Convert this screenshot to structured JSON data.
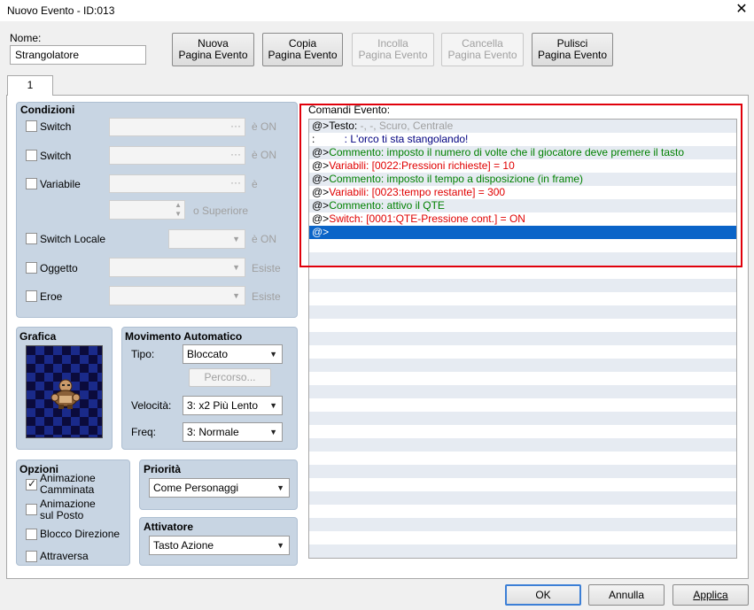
{
  "window": {
    "title": "Nuovo Evento - ID:013",
    "close_glyph": "✕"
  },
  "name": {
    "label": "Nome:",
    "value": "Strangolatore"
  },
  "toolbar": {
    "new_page": [
      "Nuova",
      "Pagina Evento"
    ],
    "copy_page": [
      "Copia",
      "Pagina Evento"
    ],
    "paste_page": [
      "Incolla",
      "Pagina Evento"
    ],
    "delete_page": [
      "Cancella",
      "Pagina Evento"
    ],
    "clear_page": [
      "Pulisci",
      "Pagina Evento"
    ]
  },
  "tabs": [
    {
      "label": "1"
    }
  ],
  "conditions": {
    "title": "Condizioni",
    "switch1": {
      "label": "Switch",
      "suffix": "è ON"
    },
    "switch2": {
      "label": "Switch",
      "suffix": "è ON"
    },
    "variable": {
      "label": "Variabile",
      "suffix": "è",
      "or_higher": "o Superiore"
    },
    "self_switch": {
      "label": "Switch Locale",
      "suffix": "è ON"
    },
    "item": {
      "label": "Oggetto",
      "suffix": "Esiste"
    },
    "actor": {
      "label": "Eroe",
      "suffix": "Esiste"
    }
  },
  "graphic": {
    "title": "Grafica"
  },
  "autonomous": {
    "title": "Movimento Automatico",
    "type_label": "Tipo:",
    "type_value": "Bloccato",
    "route_button": "Percorso...",
    "speed_label": "Velocità:",
    "speed_value": "3: x2 Più Lento",
    "freq_label": "Freq:",
    "freq_value": "3: Normale"
  },
  "options": {
    "title": "Opzioni",
    "walking_anim": [
      "Animazione",
      "Camminata"
    ],
    "stepping_anim": [
      "Animazione",
      "sul Posto"
    ],
    "direction_fix": "Blocco Direzione",
    "through": "Attraversa"
  },
  "priority": {
    "title": "Priorità",
    "value": "Come Personaggi"
  },
  "trigger": {
    "title": "Attivatore",
    "value": "Tasto Azione"
  },
  "commands": {
    "title": "Comandi Evento:",
    "lines": [
      {
        "prefix": "@>Testo",
        "text": ": ",
        "extra": "-, -, Scuro, Centrale",
        "color": "#000000",
        "extra_color": "#a0a0a0"
      },
      {
        "prefix": " :",
        "text": "          : L'orco ti sta stangolando!",
        "extra": "",
        "color": "#000080",
        "extra_color": "#000080"
      },
      {
        "prefix": "@>",
        "text": "Commento: imposto il numero di volte che il giocatore deve premere il tasto",
        "extra": "",
        "color": "#008000",
        "extra_color": "#008000"
      },
      {
        "prefix": "@>",
        "text": "Variabili: [0022:Pressioni richieste] = 10",
        "extra": "",
        "color": "#e00000",
        "extra_color": "#e00000"
      },
      {
        "prefix": "@>",
        "text": "Commento: imposto il tempo a disposizione (in frame)",
        "extra": "",
        "color": "#008000",
        "extra_color": "#008000"
      },
      {
        "prefix": "@>",
        "text": "Variabili: [0023:tempo restante] = 300",
        "extra": "",
        "color": "#e00000",
        "extra_color": "#e00000"
      },
      {
        "prefix": "@>",
        "text": "Commento: attivo il QTE",
        "extra": "",
        "color": "#008000",
        "extra_color": "#008000"
      },
      {
        "prefix": "@>",
        "text": "Switch: [0001:QTE-Pressione cont.] = ON",
        "extra": "",
        "color": "#e00000",
        "extra_color": "#e00000"
      },
      {
        "prefix": "@>",
        "text": "",
        "extra": "",
        "color": "#ffffff",
        "extra_color": "#ffffff"
      }
    ]
  },
  "footer": {
    "ok": "OK",
    "cancel": "Annulla",
    "apply": "Applica"
  },
  "colors": {
    "highlight_box": "#e0000b",
    "selection": "#0a64c8",
    "group_bg": "#c8d5e3"
  }
}
